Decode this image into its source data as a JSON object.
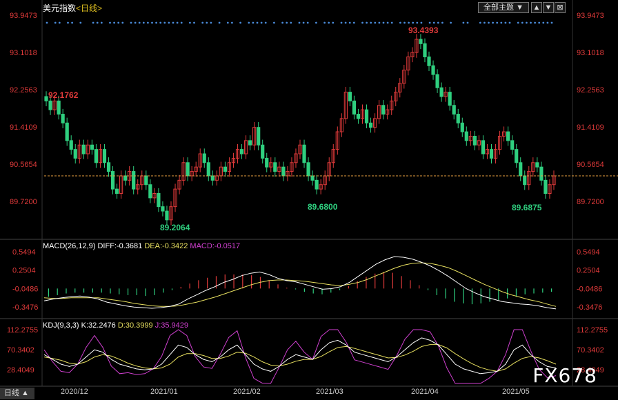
{
  "header": {
    "title": "美元指数",
    "subtitle": "<日线>",
    "theme_label": "全部主题",
    "theme_arrow": "▼",
    "btn_up": "▲",
    "btn_down": "▼",
    "btn_close": "⊠"
  },
  "period_label": "日线",
  "watermark": "FX678",
  "price_axis": [
    "93.9473",
    "93.1018",
    "92.2563",
    "91.4109",
    "90.5654",
    "89.7200"
  ],
  "macd_axis": [
    "0.5494",
    "0.2504",
    "-0.0486",
    "-0.3476"
  ],
  "kdj_axis": [
    "112.2755",
    "70.3402",
    "28.4049"
  ],
  "date_labels": [
    "2020/12",
    "2021/01",
    "2021/02",
    "2021/03",
    "2021/04",
    "2021/05"
  ],
  "macd_info": {
    "name": "MACD(26,12,9)",
    "diff": "DIFF:-0.3681",
    "dea": "DEA:-0.3422",
    "macd": "MACD:-0.0517"
  },
  "kdj_info": {
    "name": "KDJ(9,3,3)",
    "k": "K:32.2476",
    "d": "D:30.3999",
    "j": "J:35.9429"
  },
  "colors": {
    "up": "#e03a3a",
    "down": "#2fcf7f",
    "diff_line": "#ffffff",
    "dea_line": "#e8e060",
    "macd_text": "#d040d0",
    "k_line": "#ffffff",
    "d_line": "#e8e060",
    "j_line": "#d040d0"
  },
  "chart_data": {
    "type": "candlestick",
    "title": "美元指数",
    "ylim": [
      89.72,
      93.9473
    ],
    "current_level": 90.3,
    "annotations": [
      {
        "label": "92.1762",
        "value": 92.1762,
        "kind": "high"
      },
      {
        "label": "89.2064",
        "value": 89.2064,
        "kind": "low"
      },
      {
        "label": "89.6800",
        "value": 89.68,
        "kind": "low"
      },
      {
        "label": "93.4393",
        "value": 93.4393,
        "kind": "high"
      },
      {
        "label": "89.6875",
        "value": 89.6875,
        "kind": "low"
      }
    ],
    "closes": [
      92.0,
      91.8,
      92.0,
      91.7,
      91.5,
      91.1,
      90.9,
      90.7,
      91.0,
      90.8,
      91.0,
      90.9,
      90.6,
      90.9,
      90.6,
      90.4,
      90.0,
      89.9,
      90.3,
      90.2,
      90.4,
      90.0,
      90.1,
      90.3,
      90.1,
      89.8,
      89.9,
      89.6,
      89.5,
      89.3,
      89.6,
      90.0,
      90.2,
      90.6,
      90.3,
      90.4,
      90.5,
      90.8,
      90.6,
      90.3,
      90.2,
      90.3,
      90.5,
      90.4,
      90.6,
      90.7,
      90.9,
      90.8,
      91.1,
      91.0,
      91.4,
      91.0,
      90.7,
      90.5,
      90.6,
      90.4,
      90.5,
      90.3,
      90.4,
      90.6,
      90.8,
      91.0,
      90.6,
      90.3,
      90.2,
      90.0,
      90.1,
      90.3,
      90.6,
      90.9,
      91.3,
      91.6,
      92.2,
      92.0,
      91.7,
      91.6,
      91.8,
      91.5,
      91.4,
      91.6,
      91.9,
      91.7,
      91.8,
      92.0,
      92.2,
      92.4,
      92.7,
      93.0,
      93.1,
      93.4,
      93.3,
      93.0,
      92.8,
      92.6,
      92.3,
      92.1,
      92.2,
      91.9,
      91.7,
      91.5,
      91.3,
      91.1,
      91.2,
      91.0,
      91.1,
      90.8,
      90.9,
      90.7,
      90.9,
      91.2,
      91.3,
      91.1,
      90.9,
      90.6,
      90.3,
      90.1,
      90.4,
      90.6,
      90.5,
      90.2,
      89.9,
      90.1,
      90.3
    ],
    "macd": {
      "ylim": [
        -0.3476,
        0.5494
      ],
      "diff": [
        -0.25,
        -0.22,
        -0.2,
        -0.18,
        -0.17,
        -0.19,
        -0.22,
        -0.27,
        -0.3,
        -0.33,
        -0.35,
        -0.36,
        -0.37,
        -0.36,
        -0.34,
        -0.3,
        -0.22,
        -0.15,
        -0.08,
        -0.02,
        0.05,
        0.1,
        0.16,
        0.2,
        0.22,
        0.18,
        0.12,
        0.08,
        0.06,
        0.02,
        -0.02,
        -0.06,
        -0.05,
        -0.02,
        0.05,
        0.15,
        0.25,
        0.35,
        0.42,
        0.47,
        0.46,
        0.43,
        0.38,
        0.32,
        0.24,
        0.15,
        0.05,
        -0.05,
        -0.12,
        -0.18,
        -0.22,
        -0.26,
        -0.28,
        -0.3,
        -0.31,
        -0.33,
        -0.36,
        -0.38
      ],
      "dea": [
        -0.2,
        -0.21,
        -0.21,
        -0.2,
        -0.2,
        -0.2,
        -0.2,
        -0.22,
        -0.24,
        -0.26,
        -0.29,
        -0.31,
        -0.33,
        -0.34,
        -0.34,
        -0.33,
        -0.3,
        -0.27,
        -0.23,
        -0.19,
        -0.14,
        -0.09,
        -0.04,
        0.01,
        0.05,
        0.08,
        0.09,
        0.09,
        0.08,
        0.07,
        0.05,
        0.03,
        0.01,
        0.0,
        0.02,
        0.05,
        0.1,
        0.16,
        0.22,
        0.28,
        0.33,
        0.36,
        0.37,
        0.36,
        0.33,
        0.29,
        0.23,
        0.16,
        0.09,
        0.02,
        -0.04,
        -0.1,
        -0.15,
        -0.19,
        -0.23,
        -0.26,
        -0.3,
        -0.34
      ],
      "hist": [
        -0.1,
        -0.08,
        -0.06,
        -0.05,
        -0.05,
        -0.05,
        -0.05,
        -0.06,
        -0.07,
        -0.08,
        -0.08,
        -0.09,
        -0.08,
        -0.05,
        -0.02,
        0.02,
        0.06,
        0.1,
        0.13,
        0.15,
        0.17,
        0.17,
        0.17,
        0.16,
        0.14,
        0.1,
        0.05,
        0.01,
        -0.01,
        -0.04,
        -0.06,
        -0.07,
        -0.05,
        -0.02,
        0.03,
        0.09,
        0.14,
        0.18,
        0.2,
        0.19,
        0.15,
        0.1,
        0.04,
        -0.02,
        -0.08,
        -0.12,
        -0.16,
        -0.18,
        -0.19,
        -0.18,
        -0.16,
        -0.14,
        -0.12,
        -0.1,
        -0.07,
        -0.06,
        -0.05,
        -0.04
      ]
    },
    "kdj": {
      "ylim": [
        28.4049,
        112.2755
      ],
      "k": [
        60,
        50,
        40,
        35,
        40,
        55,
        70,
        65,
        50,
        40,
        35,
        30,
        28,
        30,
        40,
        60,
        80,
        75,
        60,
        50,
        45,
        55,
        70,
        80,
        60,
        40,
        30,
        25,
        35,
        50,
        60,
        55,
        50,
        70,
        85,
        90,
        80,
        65,
        60,
        55,
        50,
        45,
        55,
        70,
        85,
        95,
        90,
        80,
        60,
        40,
        30,
        25,
        20,
        22,
        25,
        40,
        70,
        80,
        60,
        45,
        35,
        32
      ],
      "d": [
        55,
        52,
        48,
        42,
        40,
        45,
        55,
        60,
        57,
        50,
        42,
        36,
        32,
        30,
        32,
        40,
        55,
        62,
        62,
        58,
        52,
        52,
        57,
        65,
        63,
        55,
        45,
        38,
        36,
        40,
        46,
        50,
        50,
        56,
        66,
        75,
        77,
        73,
        68,
        63,
        58,
        53,
        54,
        59,
        67,
        77,
        81,
        81,
        74,
        62,
        51,
        41,
        33,
        28,
        25,
        30,
        42,
        52,
        56,
        53,
        47,
        40
      ],
      "j": [
        70,
        45,
        25,
        22,
        40,
        75,
        100,
        75,
        36,
        20,
        22,
        18,
        20,
        30,
        56,
        100,
        130,
        100,
        56,
        34,
        31,
        61,
        96,
        110,
        54,
        10,
        0,
        -1,
        33,
        70,
        88,
        65,
        50,
        98,
        123,
        120,
        86,
        49,
        44,
        39,
        34,
        29,
        57,
        92,
        121,
        131,
        108,
        78,
        32,
        -4,
        -12,
        -7,
        -6,
        10,
        25,
        60,
        126,
        136,
        68,
        29,
        11,
        16
      ]
    }
  }
}
